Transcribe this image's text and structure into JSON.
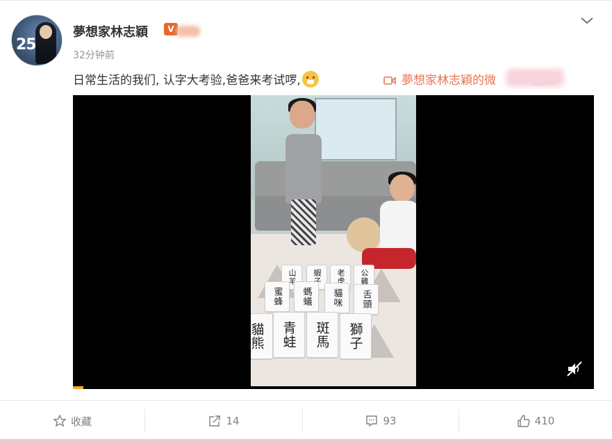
{
  "post": {
    "username": "夢想家林志穎",
    "vip_badge": "V",
    "timestamp": "32分钟前",
    "text": "日常生活的我们, 认字大考验,爸爸来考试啰,",
    "video_link_text": "夢想家林志穎的微",
    "video_link_suffix": "视频"
  },
  "avatar": {
    "number": "25"
  },
  "video": {
    "cards_row1": [
      "山羊",
      "蝦子",
      "老虎",
      "公雞"
    ],
    "cards_row2": [
      "蜜蜂",
      "螞蟻",
      "貓咪",
      "舌頭"
    ],
    "cards_row3": [
      "貓熊",
      "青蛙",
      "斑馬",
      "獅子"
    ],
    "progress_fraction": 0.02,
    "muted": true
  },
  "actions": {
    "favorite_label": "收藏",
    "repost_count": "14",
    "comment_count": "93",
    "like_count": "410"
  },
  "colors": {
    "link": "#eb7350",
    "muted_text": "#808080",
    "bottom_strip": "#f4c6d3",
    "progress": "#f5a623"
  }
}
